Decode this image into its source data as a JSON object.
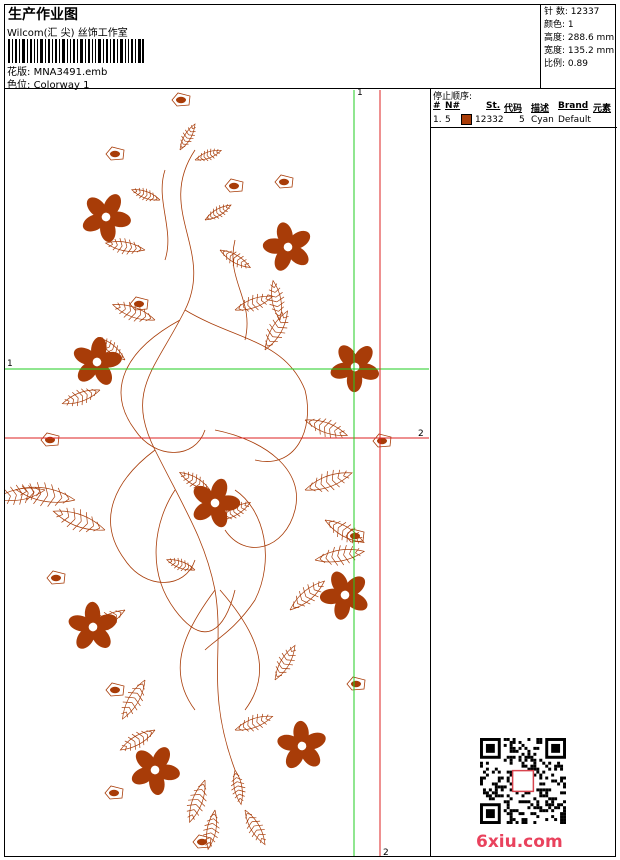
{
  "header": {
    "title": "生产作业图",
    "subtitle": "Wilcom(汇 尖) 丝饰工作室",
    "design_label": "花版:",
    "design_value": "MNA3491.emb",
    "colorway_label": "色位:",
    "colorway_value": "Colorway 1"
  },
  "stats": {
    "stitches_label": "针 数:",
    "stitches_value": "12337",
    "colors_label": "颜色:",
    "colors_value": "1",
    "height_label": "高度:",
    "height_value": "288.6 mm",
    "width_label": "宽度:",
    "width_value": "135.2 mm",
    "scale_label": "比例:",
    "scale_value": "0.89"
  },
  "stop_sequence": {
    "title": "停止顺序:",
    "columns": [
      "#",
      "N#",
      "St.",
      "代码",
      "描述",
      "Brand",
      "元素"
    ],
    "rows": [
      {
        "index": "1.",
        "n": "5",
        "stitches": "12332",
        "code": "5",
        "description": "Cyan",
        "brand": "Default",
        "color": "#a83c08"
      }
    ]
  },
  "guides": {
    "h1_label": "1",
    "h2_label": "2",
    "v1_label": "1",
    "v2_label": "2",
    "green": "#22cc22",
    "red": "#dd2222"
  },
  "thread_color": "#a83c08",
  "watermark": {
    "text": "6xiu.com",
    "color": "#e9425d"
  }
}
